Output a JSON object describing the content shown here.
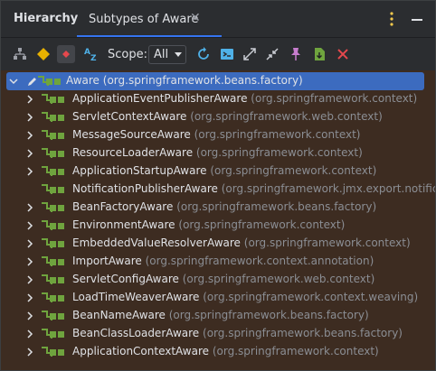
{
  "header": {
    "title": "Hierarchy",
    "tab_label": "Subtypes of Aware",
    "tab_close": "✕"
  },
  "toolbar": {
    "scope_label": "Scope:",
    "scope_value": "All",
    "icons": [
      "type-hierarchy-icon",
      "supertypes-icon",
      "subtypes-icon",
      "sort-alpha-icon",
      "refresh-icon",
      "autoscroll-to-source-icon",
      "expand-all-icon",
      "collapse-all-icon",
      "pin-icon",
      "export-icon",
      "close-icon"
    ]
  },
  "colors": {
    "tree_bg": "#3d2c21",
    "selection": "#3c6bbf",
    "package_text": "#8b8e94",
    "interface_icon": "#6fa43e"
  },
  "tree": {
    "root": {
      "name": "Aware",
      "package": "(org.springframework.beans.factory)"
    },
    "children": [
      {
        "name": "ApplicationEventPublisherAware",
        "package": "(org.springframework.context)",
        "expandable": true
      },
      {
        "name": "ServletContextAware",
        "package": "(org.springframework.web.context)",
        "expandable": true
      },
      {
        "name": "MessageSourceAware",
        "package": "(org.springframework.context)",
        "expandable": true
      },
      {
        "name": "ResourceLoaderAware",
        "package": "(org.springframework.context)",
        "expandable": true
      },
      {
        "name": "ApplicationStartupAware",
        "package": "(org.springframework.context)",
        "expandable": true
      },
      {
        "name": "NotificationPublisherAware",
        "package": "(org.springframework.jmx.export.notification)",
        "expandable": false
      },
      {
        "name": "BeanFactoryAware",
        "package": "(org.springframework.beans.factory)",
        "expandable": true
      },
      {
        "name": "EnvironmentAware",
        "package": "(org.springframework.context)",
        "expandable": true
      },
      {
        "name": "EmbeddedValueResolverAware",
        "package": "(org.springframework.context)",
        "expandable": true
      },
      {
        "name": "ImportAware",
        "package": "(org.springframework.context.annotation)",
        "expandable": true
      },
      {
        "name": "ServletConfigAware",
        "package": "(org.springframework.web.context)",
        "expandable": true
      },
      {
        "name": "LoadTimeWeaverAware",
        "package": "(org.springframework.context.weaving)",
        "expandable": true
      },
      {
        "name": "BeanNameAware",
        "package": "(org.springframework.beans.factory)",
        "expandable": true
      },
      {
        "name": "BeanClassLoaderAware",
        "package": "(org.springframework.beans.factory)",
        "expandable": true
      },
      {
        "name": "ApplicationContextAware",
        "package": "(org.springframework.context)",
        "expandable": true
      }
    ]
  }
}
